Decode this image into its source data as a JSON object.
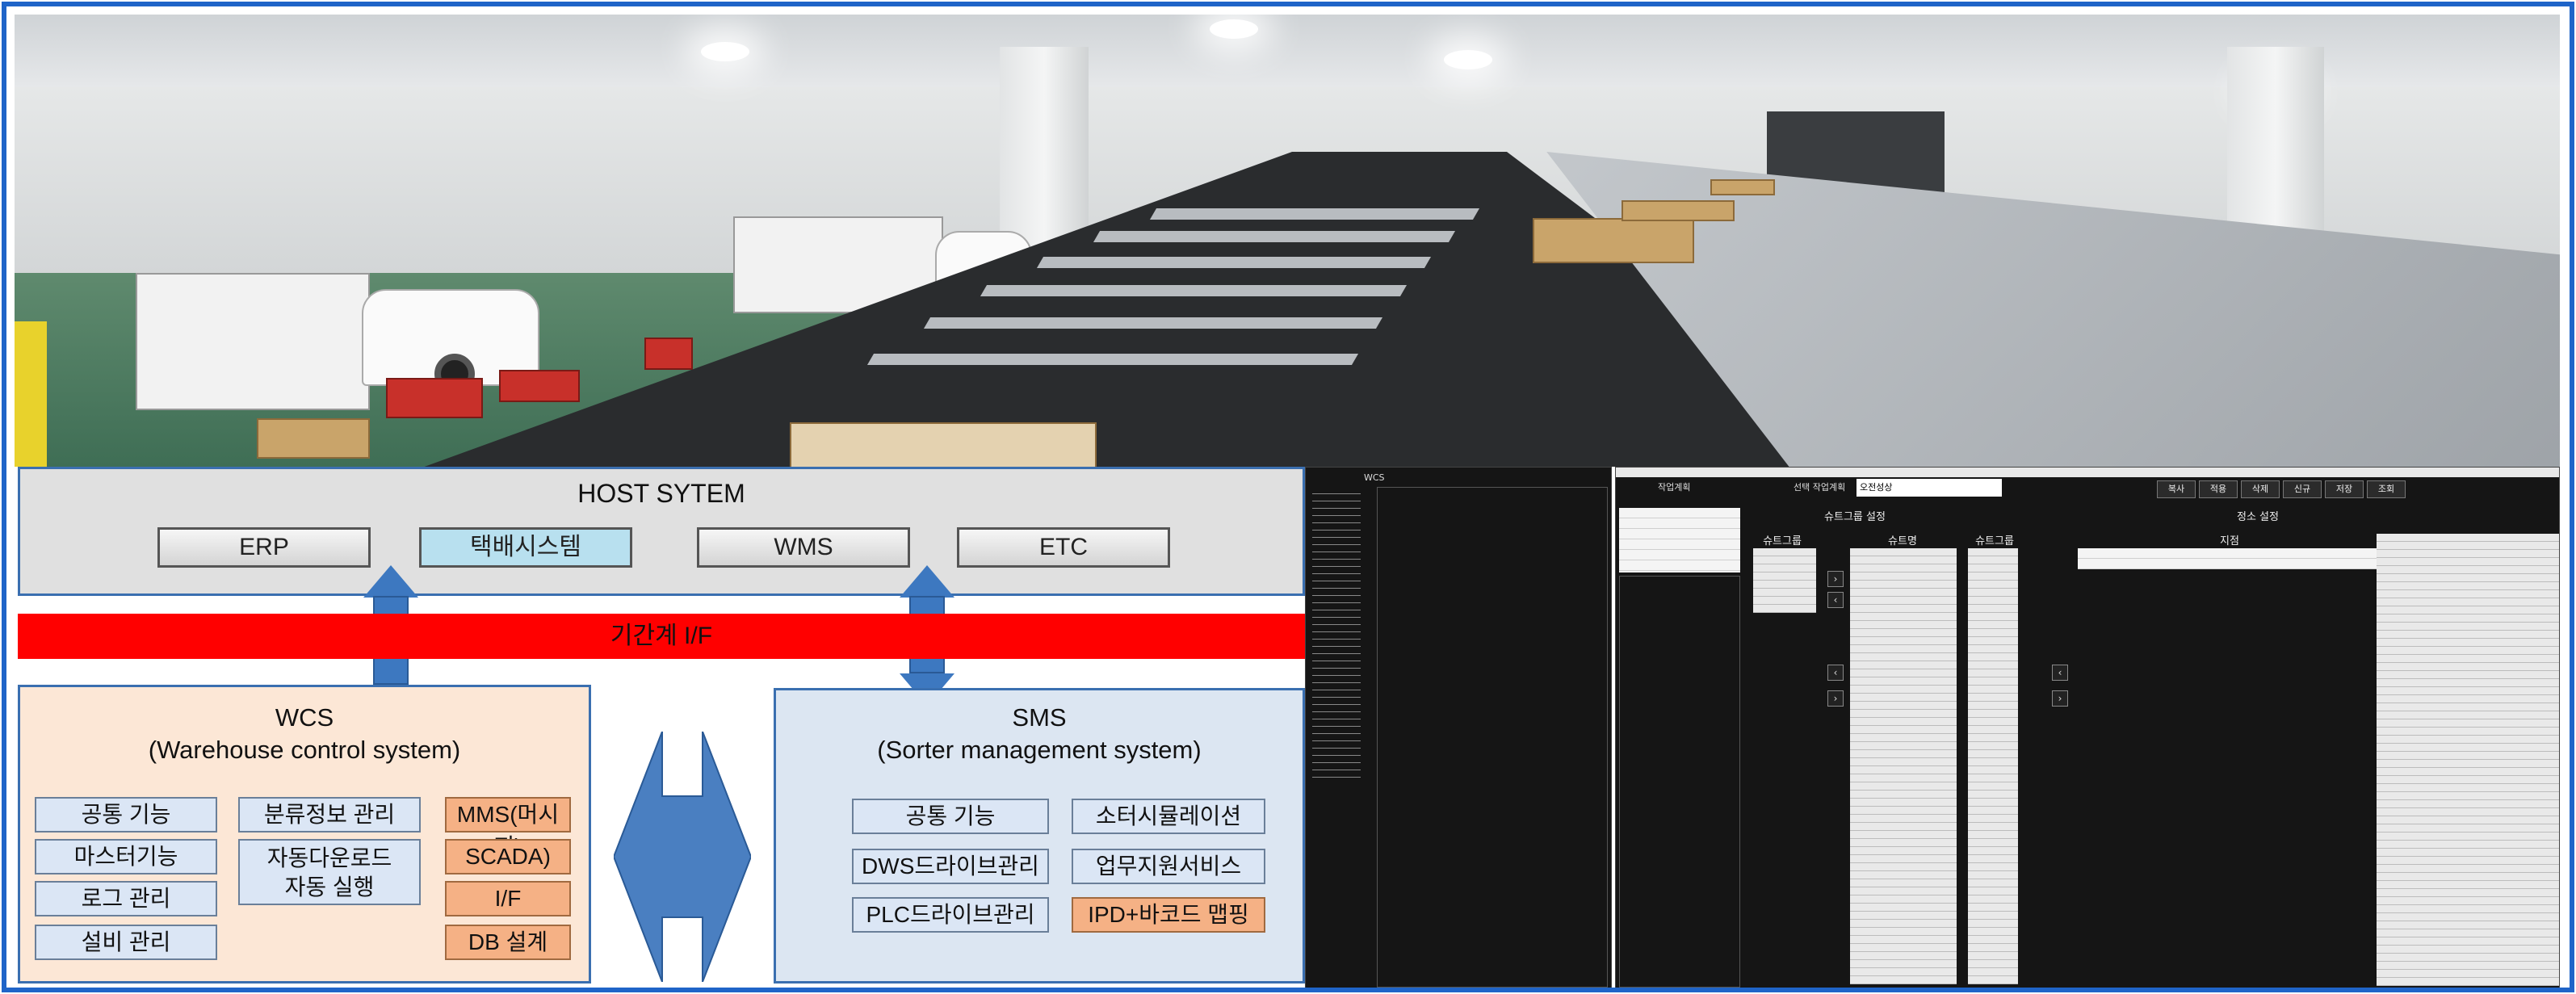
{
  "host": {
    "title": "HOST SYTEM",
    "systems": [
      "ERP",
      "택배시스템",
      "WMS",
      "ETC"
    ]
  },
  "interface_band": {
    "label": "기간계 I/F"
  },
  "wcs": {
    "title_line1": "WCS",
    "title_line2": "(Warehouse control system)",
    "col1": [
      "공통 기능",
      "마스터기능",
      "로그 관리",
      "설비 관리"
    ],
    "col2_item1": "분류정보 관리",
    "col2_item2_line1": "자동다운로드",
    "col2_item2_line2": "자동 실행",
    "col3": [
      "MMS(머시지)",
      "SCADA)",
      "I/F",
      "DB 설계"
    ]
  },
  "sms": {
    "title_line1": "SMS",
    "title_line2": "(Sorter management system)",
    "left": [
      "공통 기능",
      "DWS드라이브관리",
      "PLC드라이브관리"
    ],
    "right": [
      "소터시뮬레이션",
      "업무지원서비스",
      "IPD+바코드 맵핑"
    ]
  },
  "screens": {
    "wcs_screen_title": "WCS",
    "work_plan_label": "작업계획",
    "selected_plan_label": "선택 작업계획",
    "selected_plan_value": "오전성상",
    "chute_group_setting": "슈트그룹 설정",
    "destination_setting": "정소 설정",
    "chute_group": "슈트그룹",
    "chute_name": "슈트명",
    "chute_group_2": "슈트그룹",
    "destination": "지점",
    "toolbar": [
      "복사",
      "적용",
      "삭제",
      "신규",
      "저장",
      "조회"
    ]
  },
  "colors": {
    "frame": "#1f64c8",
    "host_bg": "#e0e0e0",
    "highlight_system": "#b8e0ef",
    "interface_band": "#ff0000",
    "wcs_bg": "#fce7d6",
    "sms_bg": "#dce6f2",
    "orange_cell": "#f5b185",
    "blue_cell": "#dbe6f5",
    "arrow": "#3d78c0"
  }
}
